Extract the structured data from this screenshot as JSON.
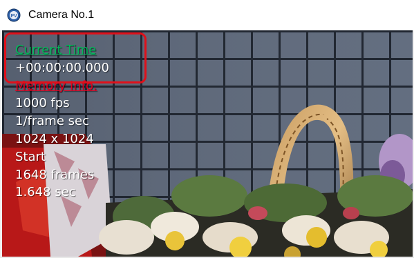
{
  "window": {
    "title": "Camera No.1",
    "icon": "camera-app-icon"
  },
  "overlay": {
    "current_time_label": "Current Time",
    "current_time_value": "+00:00:00.000",
    "memory_info_label": "Memory Info.",
    "fps": "1000 fps",
    "shutter": "1/frame sec",
    "resolution": "1024 x 1024",
    "trigger_mode": "Start",
    "frames": "1648 frames",
    "duration": "1.648 sec"
  },
  "colors": {
    "current_time_label": "#00ba5a",
    "memory_info_label": "#e2001f",
    "overlay_text": "#ffffff",
    "highlight_box": "#e0101a"
  }
}
